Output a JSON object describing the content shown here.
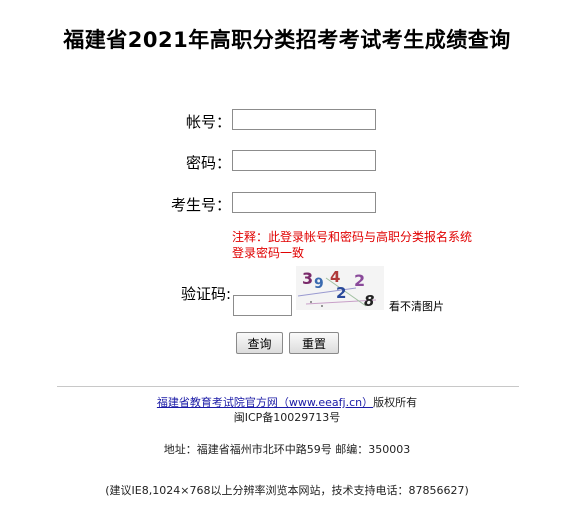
{
  "title": "福建省2021年高职分类招考考试考生成绩查询",
  "form": {
    "account_label": "帐号：",
    "password_label": "密码：",
    "exam_no_label": "考生号：",
    "note": "注释：此登录帐号和密码与高职分类报名系统登录密码一致",
    "captcha_label": "验证码:",
    "captcha_text": "3942 2 8",
    "refresh_label": "看不清图片",
    "query_button": "查询",
    "reset_button": "重置"
  },
  "footer": {
    "site_link": "福建省教育考试院官方网（www.eeafj.cn）",
    "rights": "版权所有",
    "icp": "闽ICP备10029713号",
    "address": "地址：福建省福州市北环中路59号 邮编：350003",
    "advice": "(建议IE8,1024×768以上分辨率浏览本网站，技术支持电话：87856627)"
  }
}
